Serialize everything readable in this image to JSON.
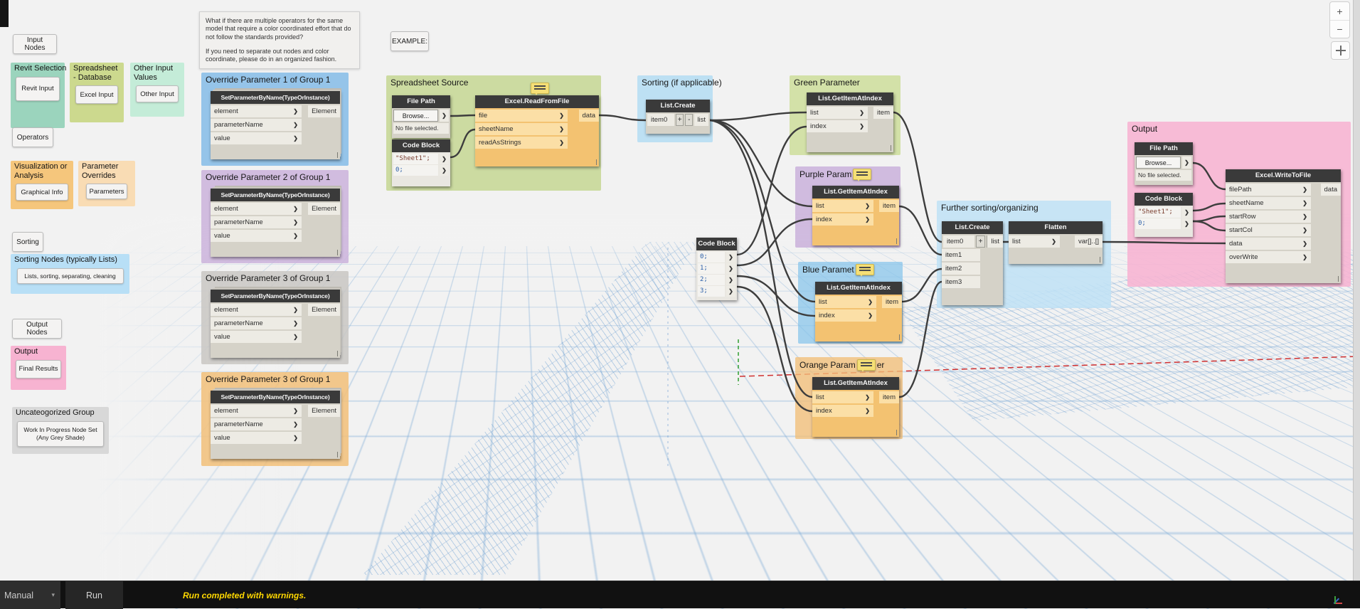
{
  "ui": {
    "buttons": {
      "input_nodes": "Input Nodes",
      "operators": "Operators",
      "sorting": "Sorting",
      "output_nodes": "Output Nodes",
      "example": "EXAMPLE:"
    },
    "view_controls": {
      "zoom_in": "+",
      "zoom_out": "−"
    },
    "bottom_bar": {
      "mode": "Manual",
      "caret": "▾",
      "run": "Run",
      "status": "Run completed with warnings."
    },
    "icons": {
      "chevron": "❯",
      "caret_down": "▾",
      "note": "sticky-note",
      "pan": "move-cross"
    }
  },
  "note": {
    "para1": "What if there are multiple operators for the same model that require a color coordinated effort that do not follow the standards provided?",
    "para2": "If you need to separate out nodes and color coordinate, please do in an organized fashion."
  },
  "legend": {
    "revit_selection": {
      "title": "Revit Selection",
      "button": "Revit Input",
      "color": "#9bd4bd"
    },
    "spreadsheet_database": {
      "title": "Spreadsheet - Database",
      "button": "Excel Input",
      "color": "#ccd98e"
    },
    "other_input_values": {
      "title": "Other Input Values",
      "button": "Other Input",
      "color": "#c4ecd8"
    },
    "visualization_or_analysis": {
      "title": "Visualization or Analysis",
      "button": "Graphical Info",
      "color": "#f5c67c"
    },
    "parameter_overrides": {
      "title": "Parameter Overrides",
      "button": "Parameters",
      "color": "#f9dcb4"
    },
    "sorting_nodes": {
      "title": "Sorting Nodes (typically Lists)",
      "button": "Lists, sorting, separating, cleaning",
      "color": "#b8dff6"
    },
    "output": {
      "title": "Output",
      "button": "Final Results",
      "color": "#f7b3d1"
    },
    "uncategorized": {
      "title": "Uncateogorized Group",
      "button": "Work In Progress Node Set (Any Grey Shade)",
      "color": "#d8d8d8"
    }
  },
  "override_groups": [
    {
      "title": "Override Parameter 1 of Group 1",
      "color": "#85bce8"
    },
    {
      "title": "Override Parameter 2 of Group 1",
      "color": "#cbb3dc"
    },
    {
      "title": "Override Parameter 3 of Group 1",
      "color": "#c9c7c3"
    },
    {
      "title": "Override Parameter 3 of Group 1",
      "color": "#f2bf79"
    }
  ],
  "set_param_node": {
    "title": "SetParameterByName(TypeOrInstance)",
    "inputs": [
      "element",
      "parameterName",
      "value"
    ],
    "output": "Element"
  },
  "spreadsheet_source": {
    "title": "Spreadsheet Source",
    "color": "#c6d795",
    "file_path": {
      "title": "File Path",
      "browse": "Browse...",
      "status": "No file selected."
    },
    "code_block": {
      "title": "Code Block",
      "lines": [
        "\"Sheet1\";",
        "0;"
      ]
    },
    "excel_read": {
      "title": "Excel.ReadFromFile",
      "inputs": [
        "file",
        "sheetName",
        "readAsStrings"
      ],
      "output": "data"
    }
  },
  "sorting_group": {
    "title": "Sorting (if applicable)",
    "color": "#b5ddf2",
    "list_create": {
      "title": "List.Create",
      "inputs": [
        "item0"
      ],
      "plus": "+",
      "minus": "-",
      "output": "list"
    }
  },
  "param_groups": [
    {
      "title": "Green Parameter",
      "color": "#cede9d"
    },
    {
      "title": "Purple Param",
      "color": "#cbb3dc"
    },
    {
      "title": "Blue Paramet",
      "color": "#85c3ea"
    },
    {
      "title": "Orange Param",
      "title_suffix": "er",
      "color": "#f2bf79"
    }
  ],
  "getitem_node": {
    "title": "List.GetItemAtIndex",
    "inputs": [
      "list",
      "index"
    ],
    "output": "item"
  },
  "index_code_block": {
    "title": "Code Block",
    "lines": [
      "0;",
      "1;",
      "2;",
      "3;"
    ]
  },
  "further_sorting": {
    "title": "Further sorting/organizing",
    "color": "#bfe2f6",
    "list_create": {
      "title": "List.Create",
      "inputs": [
        "item0",
        "item1",
        "item2",
        "item3"
      ],
      "plus": "+",
      "minus": "-",
      "output": "list"
    },
    "flatten": {
      "title": "Flatten",
      "input": "list",
      "output": "var[]..[]"
    }
  },
  "output_group": {
    "title": "Output",
    "color": "#f7b3d1",
    "file_path": {
      "title": "File Path",
      "browse": "Browse...",
      "status": "No file selected."
    },
    "code_block": {
      "title": "Code Block",
      "lines": [
        "\"Sheet1\";",
        "0;"
      ]
    },
    "excel_write": {
      "title": "Excel.WriteToFile",
      "inputs": [
        "filePath",
        "sheetName",
        "startRow",
        "startCol",
        "data",
        "overWrite"
      ],
      "output": "data"
    }
  },
  "wire_color": "#3d3d3d"
}
